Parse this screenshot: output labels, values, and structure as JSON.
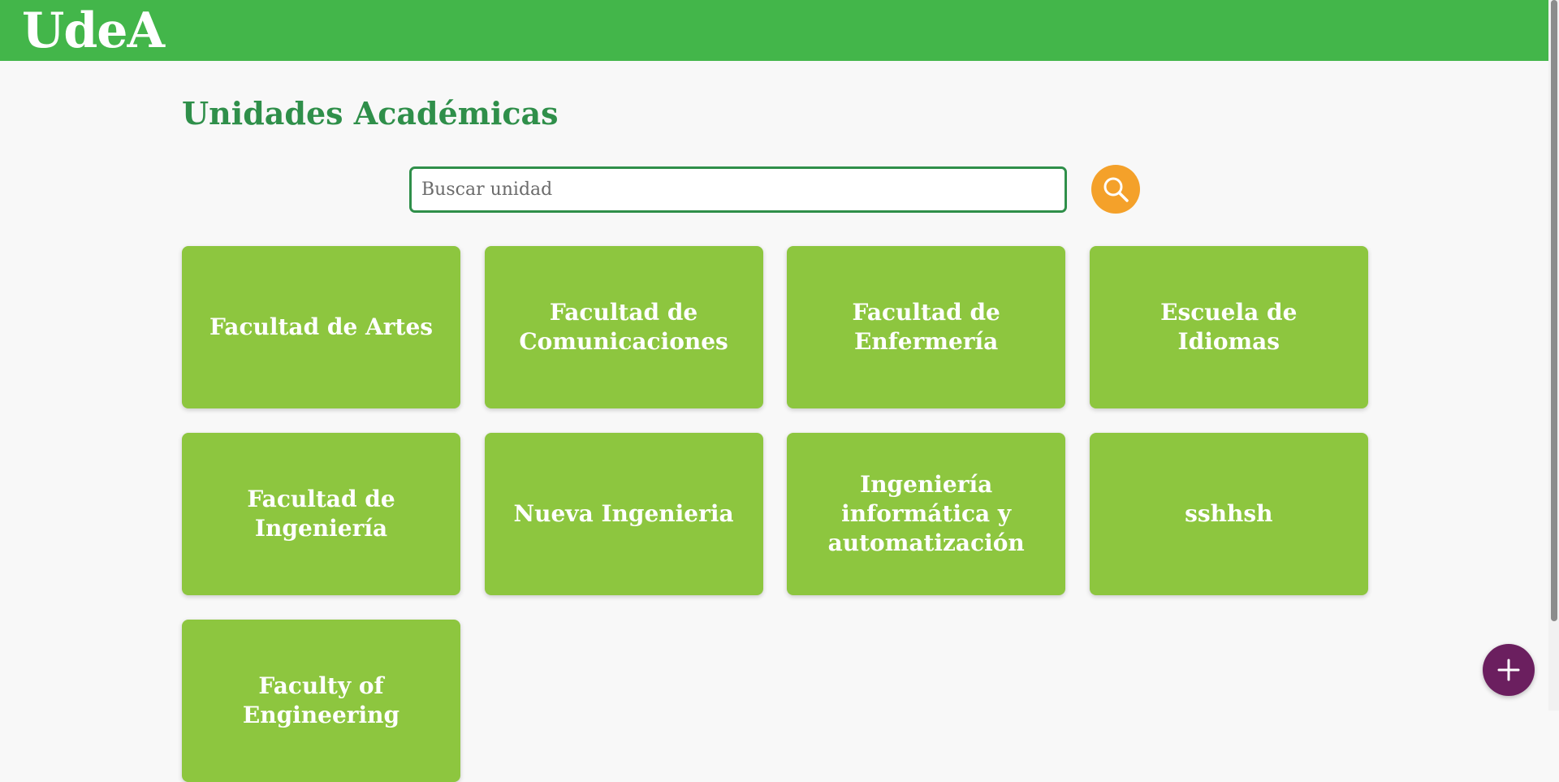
{
  "header": {
    "logo_text": "UdeA"
  },
  "main": {
    "title": "Unidades Académicas",
    "search": {
      "placeholder": "Buscar unidad",
      "value": "",
      "button_icon": "search-icon"
    },
    "units": [
      {
        "label": "Facultad de Artes"
      },
      {
        "label": "Facultad de Comunicaciones"
      },
      {
        "label": "Facultad de Enfermería"
      },
      {
        "label": "Escuela de Idiomas"
      },
      {
        "label": "Facultad de Ingeniería"
      },
      {
        "label": "Nueva Ingenieria"
      },
      {
        "label": "Ingeniería informática y automatización"
      },
      {
        "label": "sshhsh"
      },
      {
        "label": "Faculty of Engineering"
      }
    ]
  },
  "fab": {
    "icon": "plus-icon"
  },
  "colors": {
    "header": "#43b64a",
    "title": "#2f8f4a",
    "card": "#8dc63f",
    "search_button": "#f4a12a",
    "fab": "#6b1f5f"
  }
}
